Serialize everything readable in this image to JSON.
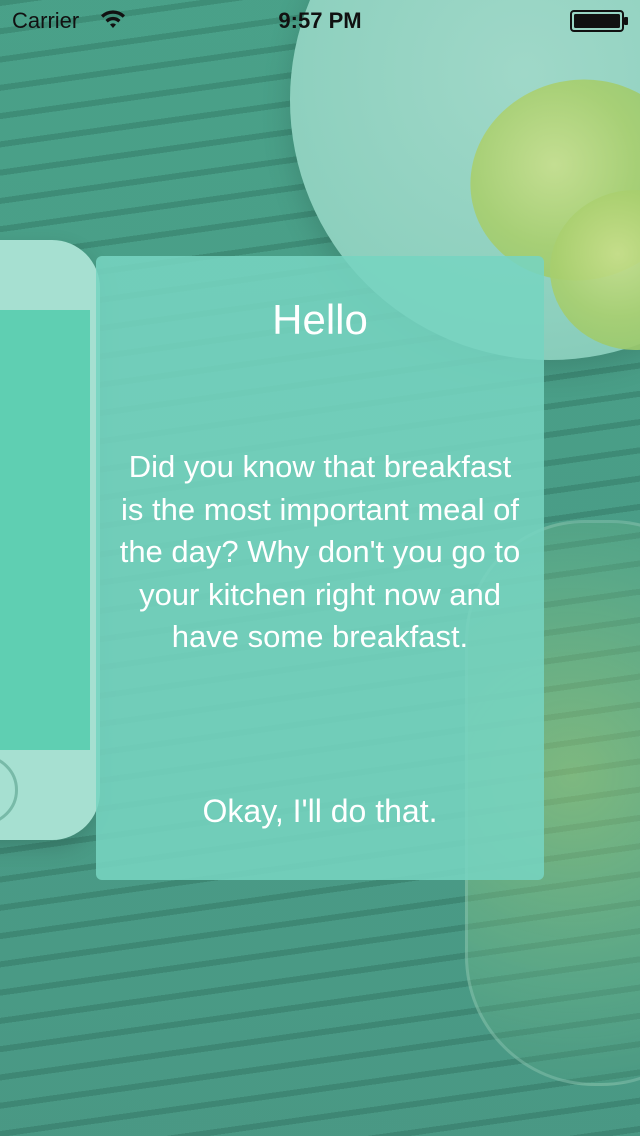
{
  "status_bar": {
    "carrier": "Carrier",
    "time": "9:57 PM",
    "wifi_icon": "wifi-icon",
    "battery_icon": "battery-icon"
  },
  "card": {
    "title": "Hello",
    "message": "Did you know that breakfast is the most important meal of the day? Why don't you go to your kitchen right now and have some breakfast.",
    "button_label": "Okay, I'll do that."
  },
  "colors": {
    "card_background": "#76D4C0",
    "background_tint": "#46A087",
    "text": "#FFFFFF"
  }
}
